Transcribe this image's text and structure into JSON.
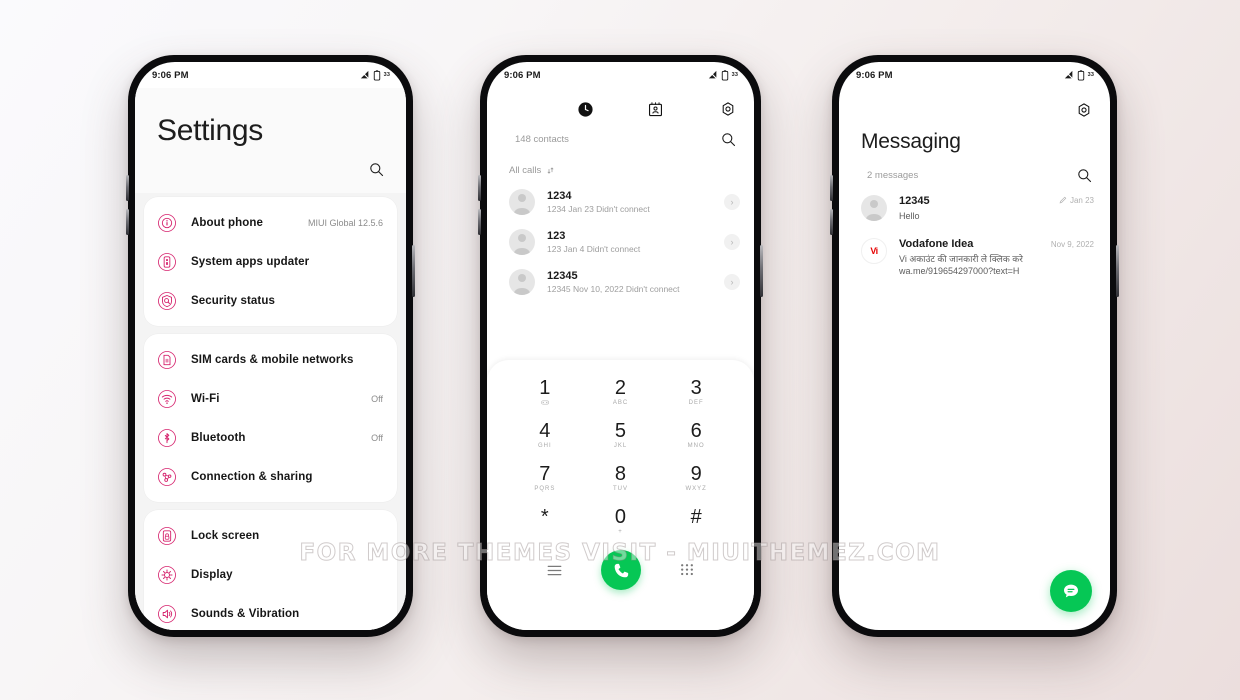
{
  "watermark": "FOR MORE THEMES VISIT - MIUITHEMEZ.COM",
  "theme": {
    "accent_pink": "#d6246e",
    "accent_green": "#06c755",
    "vi_red": "#e60000",
    "bg_start": "#fafafd",
    "bg_end": "#ebdedd"
  },
  "status_bar": {
    "time": "9:06 PM",
    "battery": "33"
  },
  "settings": {
    "title": "Settings",
    "search_icon": "search-icon",
    "groups": [
      {
        "rows": [
          {
            "icon": "info-circle-icon",
            "label": "About phone",
            "value": "MIUI Global 12.5.6"
          },
          {
            "icon": "system-update-icon",
            "label": "System apps updater",
            "value": ""
          },
          {
            "icon": "security-shield-icon",
            "label": "Security status",
            "value": ""
          }
        ]
      },
      {
        "rows": [
          {
            "icon": "sim-card-icon",
            "label": "SIM cards & mobile networks",
            "value": ""
          },
          {
            "icon": "wifi-icon",
            "label": "Wi-Fi",
            "value": "Off"
          },
          {
            "icon": "bluetooth-icon",
            "label": "Bluetooth",
            "value": "Off"
          },
          {
            "icon": "connection-sharing-icon",
            "label": "Connection & sharing",
            "value": ""
          }
        ]
      },
      {
        "rows": [
          {
            "icon": "lock-screen-icon",
            "label": "Lock screen",
            "value": ""
          },
          {
            "icon": "display-brightness-icon",
            "label": "Display",
            "value": ""
          },
          {
            "icon": "sound-vibration-icon",
            "label": "Sounds & Vibration",
            "value": ""
          }
        ]
      }
    ]
  },
  "dialer": {
    "tabs": [
      {
        "name": "recents-tab",
        "icon": "clock-filled-icon",
        "active": true
      },
      {
        "name": "contacts-tab",
        "icon": "contact-card-icon",
        "active": false
      }
    ],
    "settings_icon": "gear-icon",
    "contacts_count": "148 contacts",
    "search_icon": "search-icon",
    "filter_label": "All calls",
    "filter_icon": "sort-icon",
    "calls": [
      {
        "name": "1234",
        "meta": "1234  Jan 23  Didn't connect"
      },
      {
        "name": "123",
        "meta": "123  Jan 4  Didn't connect"
      },
      {
        "name": "12345",
        "meta": "12345  Nov 10, 2022  Didn't connect"
      }
    ],
    "keys": [
      {
        "digit": "1",
        "letters": ""
      },
      {
        "digit": "2",
        "letters": "ABC"
      },
      {
        "digit": "3",
        "letters": "DEF"
      },
      {
        "digit": "4",
        "letters": "GHI"
      },
      {
        "digit": "5",
        "letters": "JKL"
      },
      {
        "digit": "6",
        "letters": "MNO"
      },
      {
        "digit": "7",
        "letters": "PQRS"
      },
      {
        "digit": "8",
        "letters": "TUV"
      },
      {
        "digit": "9",
        "letters": "WXYZ"
      },
      {
        "digit": "*",
        "letters": ""
      },
      {
        "digit": "0",
        "letters": "+"
      },
      {
        "digit": "#",
        "letters": ""
      }
    ],
    "bottom": {
      "menu_icon": "menu-icon",
      "call_icon": "phone-call-icon",
      "keypad_icon": "keypad-icon"
    }
  },
  "messaging": {
    "settings_icon": "gear-icon",
    "title": "Messaging",
    "count": "2 messages",
    "search_icon": "search-icon",
    "threads": [
      {
        "avatar": "person-avatar",
        "name": "12345",
        "preview": "Hello",
        "date": "Jan 23",
        "has_draft_icon": true
      },
      {
        "avatar": "vi-logo",
        "avatar_text": "Vi",
        "name": "Vodafone Idea",
        "preview": "Vi अकाउंट की जानकारी ले क्लिक करे wa.me/919654297000?text=H",
        "date": "Nov 9, 2022",
        "has_draft_icon": false
      }
    ],
    "compose_icon": "chat-bubble-icon"
  }
}
